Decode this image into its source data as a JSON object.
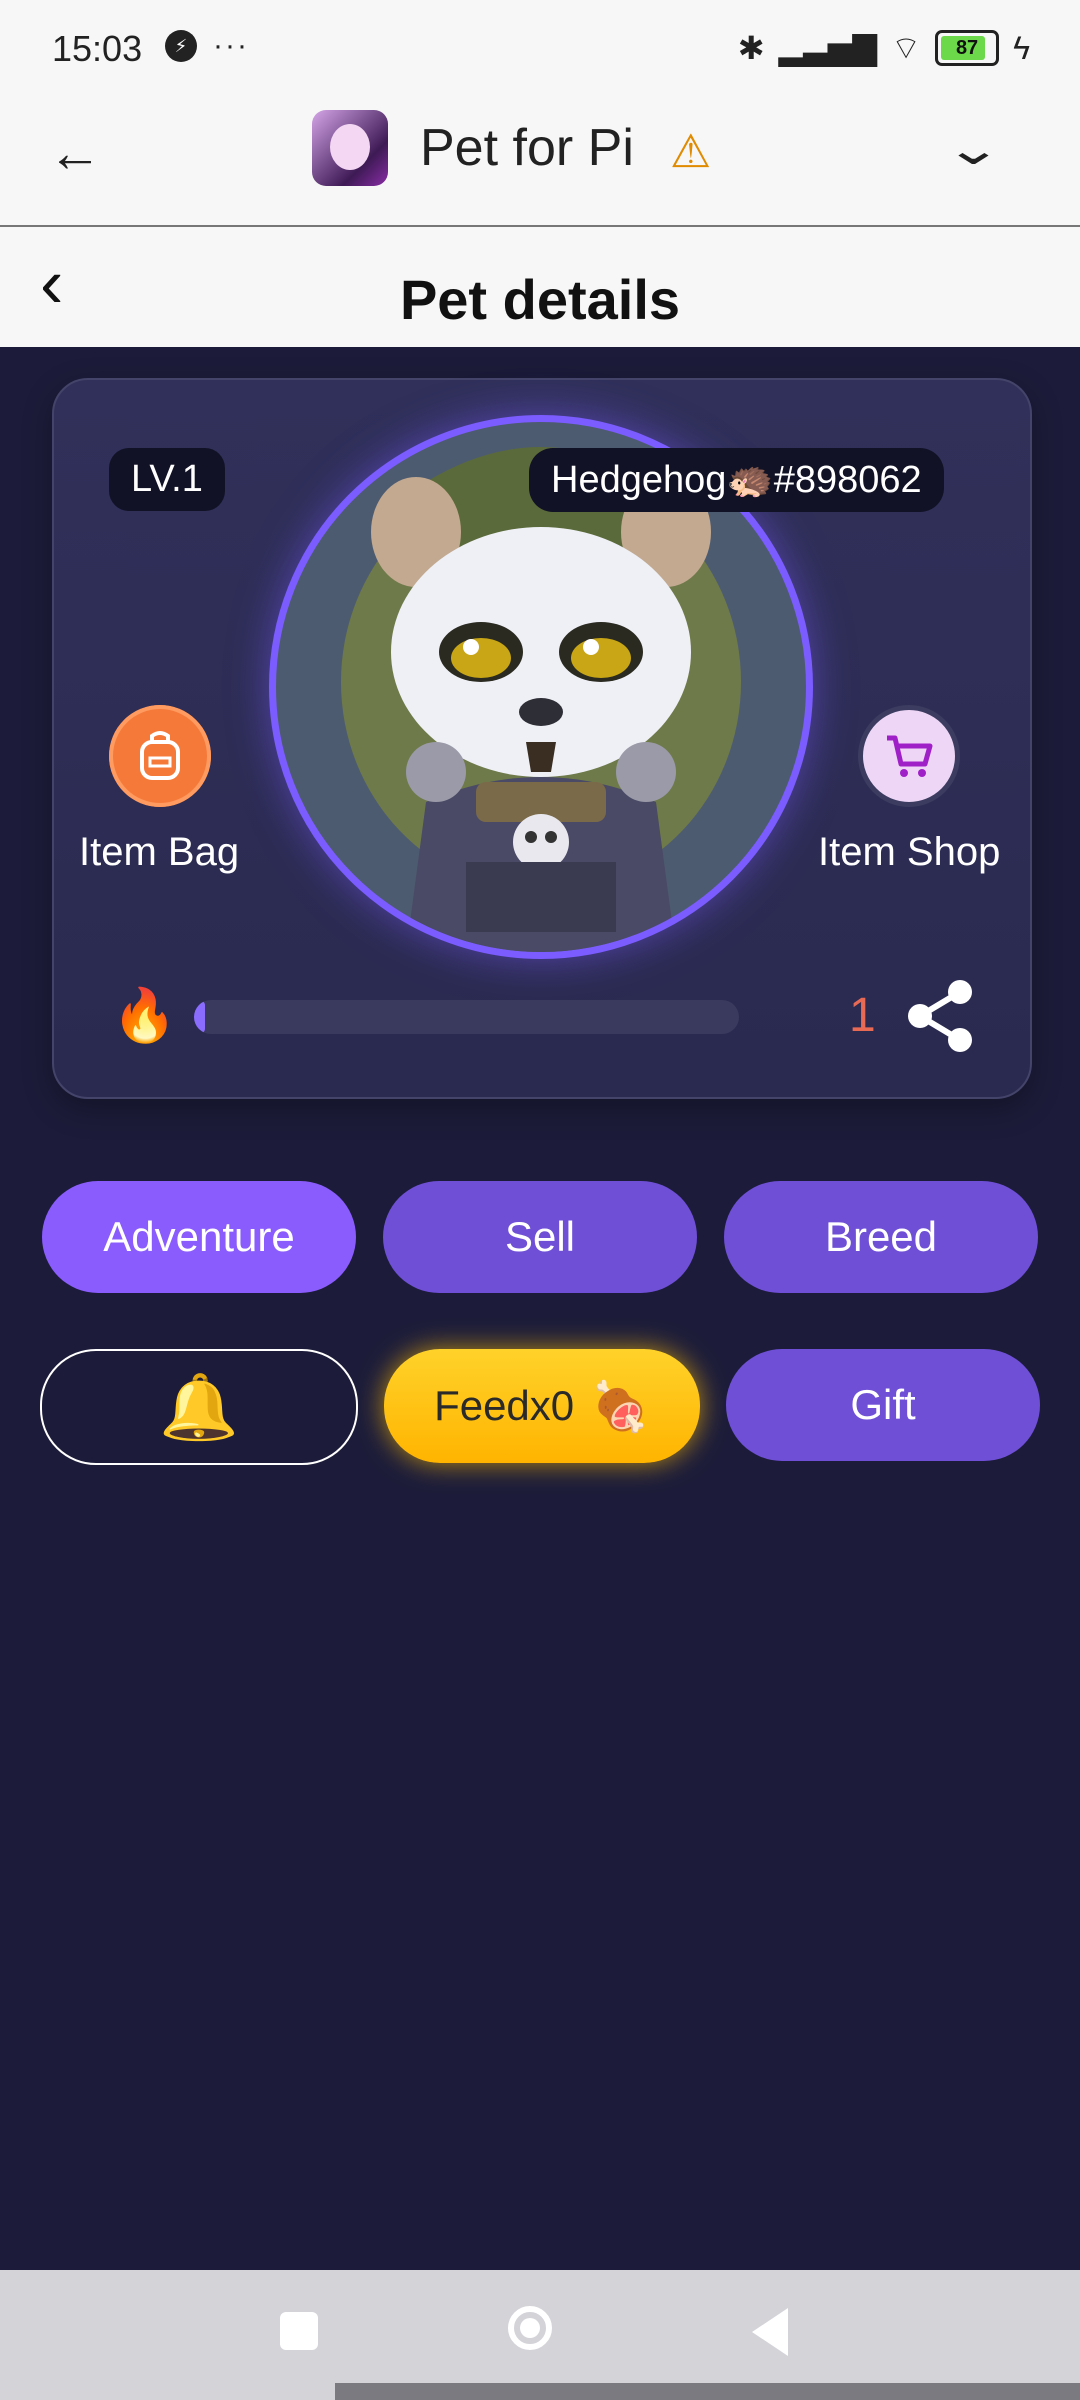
{
  "status_bar": {
    "time": "15:03",
    "battery": "87",
    "icons": [
      "messenger-icon",
      "more-dots-icon",
      "bluetooth-icon",
      "signal-icon",
      "wifi-icon",
      "battery-icon",
      "charging-icon"
    ]
  },
  "app_header": {
    "title": "Pet for Pi",
    "warning_icon": "⚠",
    "back_icon": "←",
    "menu_icon": "⌄"
  },
  "page": {
    "title": "Pet details",
    "back_icon": "‹"
  },
  "pet": {
    "level": "LV.1",
    "name": "Hedgehog🦔#898062",
    "item_bag_label": "Item Bag",
    "item_shop_label": "Item Shop",
    "fire_icon": "🔥",
    "count": "1",
    "progress_fraction": 0.01
  },
  "actions": {
    "adventure": "Adventure",
    "sell": "Sell",
    "breed": "Breed",
    "bell": "🔔",
    "feed": "Feedx0",
    "feed_emoji": "🍖",
    "gift": "Gift"
  },
  "colors": {
    "background": "#1c1c3a",
    "primary": "#6e4fd6",
    "adventure": "#8a5cfd",
    "feed": "#ffc20e",
    "accent_ring": "#7b5cff"
  }
}
